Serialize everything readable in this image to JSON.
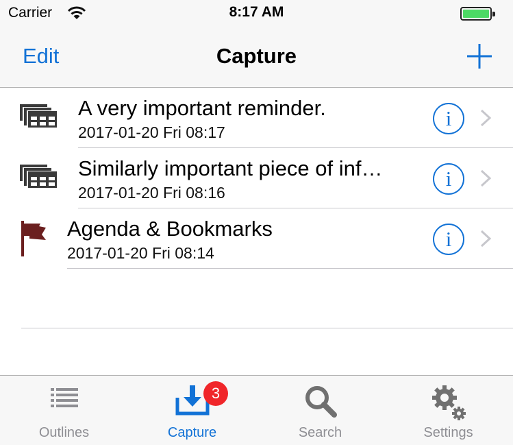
{
  "status_bar": {
    "carrier": "Carrier",
    "time": "8:17 AM",
    "wifi_icon": "wifi-icon",
    "battery_icon": "battery-full-icon",
    "battery_level": 1.0,
    "battery_color": "#4cd964"
  },
  "nav": {
    "edit_label": "Edit",
    "title": "Capture",
    "add_icon": "plus-icon"
  },
  "items": [
    {
      "icon": "cards-icon",
      "title": "A very important reminder.",
      "date": "2017-01-20 Fri 08:17"
    },
    {
      "icon": "cards-icon",
      "title": "Similarly important piece of inf…",
      "date": "2017-01-20 Fri 08:16"
    },
    {
      "icon": "flag-icon",
      "title": "Agenda & Bookmarks",
      "date": "2017-01-20 Fri 08:14"
    }
  ],
  "tabs": [
    {
      "label": "Outlines",
      "icon": "list-icon",
      "active": false
    },
    {
      "label": "Capture",
      "icon": "inbox-download-icon",
      "active": true,
      "badge": "3"
    },
    {
      "label": "Search",
      "icon": "magnifier-icon",
      "active": false
    },
    {
      "label": "Settings",
      "icon": "gears-icon",
      "active": false
    }
  ],
  "colors": {
    "accent": "#1272d6",
    "badge": "#f0262a",
    "inactive_tab": "#8e8e93",
    "flag": "#6b1f1f",
    "cards": "#3a3a3a"
  }
}
